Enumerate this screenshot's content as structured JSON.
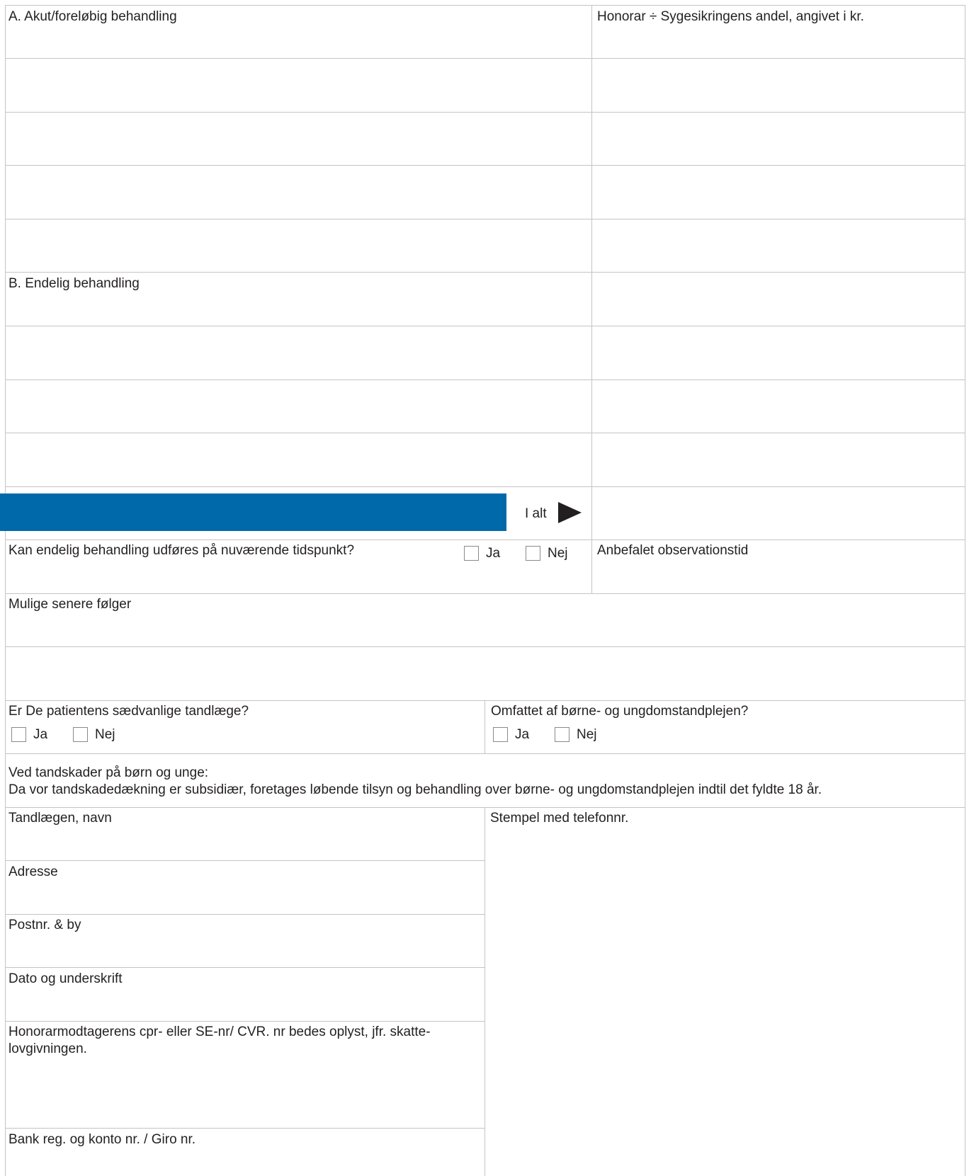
{
  "treatment": {
    "section_a": "A. Akut/foreløbig behandling",
    "fee_header": "Honorar ÷ Sygesikringens andel, angivet i kr.",
    "section_b": "B. Endelig behandling",
    "total_label": "I alt"
  },
  "final_treatment": {
    "question": "Kan endelig behandling udføres på nuværende tidspunkt?",
    "yes": "Ja",
    "no": "Nej",
    "observation_label": "Anbefalet observationstid"
  },
  "consequences": {
    "label": "Mulige senere følger"
  },
  "usual_dentist": {
    "question": "Er De patientens sædvanlige tandlæge?",
    "yes": "Ja",
    "no": "Nej"
  },
  "youth_care": {
    "question": "Omfattet af børne- og ungdomstandplejen?",
    "yes": "Ja",
    "no": "Nej"
  },
  "notice": {
    "line1": "Ved tandskader på børn og unge:",
    "line2": "Da vor tandskadedækning er subsidiær, foretages løbende tilsyn og behandling over børne- og ungdomstandplejen indtil det fyldte 18 år."
  },
  "dentist": {
    "name_label": "Tandlægen, navn",
    "address_label": "Adresse",
    "postal_label": "Postnr. & by",
    "date_sign_label": "Dato og underskrift",
    "cpr_label": "Honorarmodtagerens cpr- eller SE-nr/ CVR. nr bedes oplyst, jfr. skatte-lovgivningen.",
    "bank_label": "Bank reg. og konto nr. / Giro nr.",
    "stamp_label": "Stempel med telefonnr."
  }
}
